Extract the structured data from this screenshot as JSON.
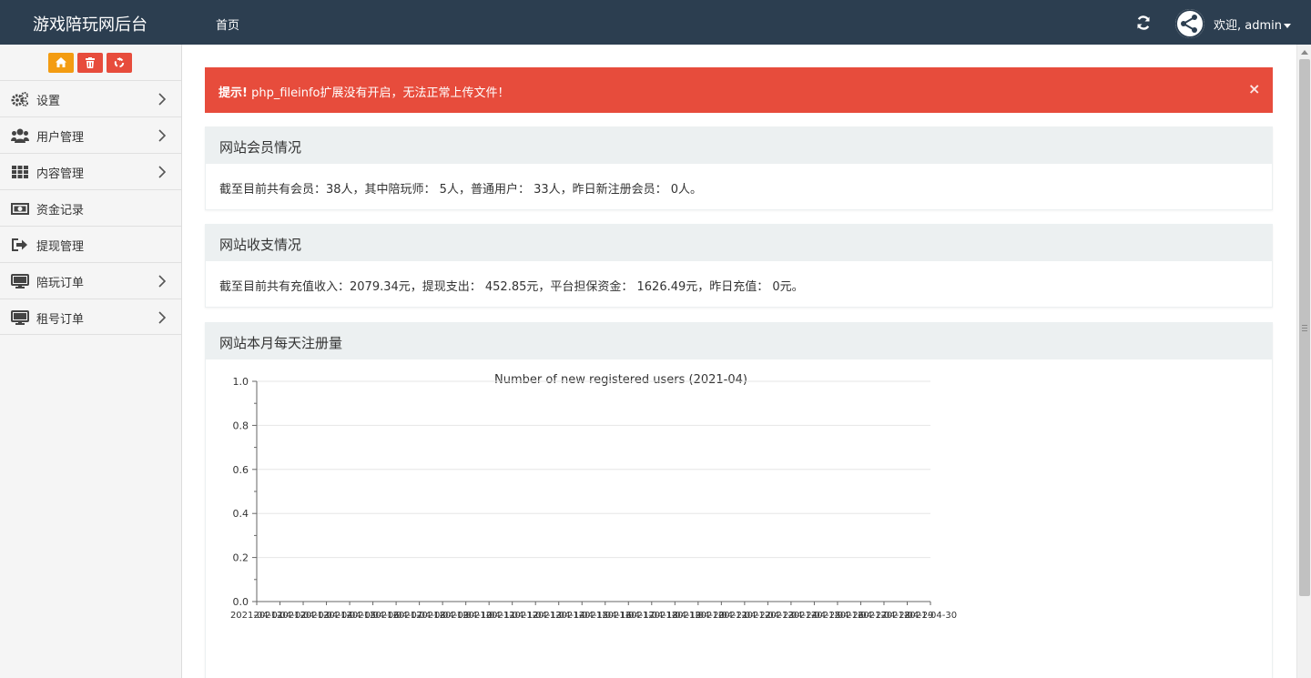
{
  "header": {
    "brand": "游戏陪玩网后台",
    "nav_home": "首页",
    "user_label": "欢迎, admin"
  },
  "sidebar": {
    "quick_buttons": [
      {
        "icon": "home-icon",
        "color": "#f39c12"
      },
      {
        "icon": "trash-icon",
        "color": "#e74c3c"
      },
      {
        "icon": "recycle-icon",
        "color": "#e74c3c"
      }
    ],
    "items": [
      {
        "label": "设置",
        "icon": "gears-icon",
        "has_children": true
      },
      {
        "label": "用户管理",
        "icon": "users-icon",
        "has_children": true
      },
      {
        "label": "内容管理",
        "icon": "grid-icon",
        "has_children": true
      },
      {
        "label": "资金记录",
        "icon": "money-icon",
        "has_children": false
      },
      {
        "label": "提现管理",
        "icon": "sign-out-icon",
        "has_children": false
      },
      {
        "label": "陪玩订单",
        "icon": "desktop-icon",
        "has_children": true
      },
      {
        "label": "租号订单",
        "icon": "desktop-icon",
        "has_children": true
      }
    ]
  },
  "alert": {
    "prefix": "提示!",
    "message": "php_fileinfo扩展没有开启，无法正常上传文件！",
    "close": "×"
  },
  "panels": {
    "members": {
      "title": "网站会员情况",
      "text": "截至目前共有会员：38人，其中陪玩师： 5人，普通用户： 33人，昨日新注册会员： 0人。"
    },
    "finance": {
      "title": "网站收支情况",
      "text": "截至目前共有充值收入：2079.34元，提现支出： 452.85元，平台担保资金： 1626.49元，昨日充值： 0元。"
    },
    "registrations": {
      "title": "网站本月每天注册量"
    }
  },
  "colors": {
    "navbar": "#2c3e50",
    "alert": "#e74c3c",
    "panel_heading": "#ecf0f1",
    "home_button": "#f39c12",
    "danger_button": "#e74c3c"
  },
  "chart_data": {
    "type": "line",
    "title": "Number of new registered users (2021-04)",
    "x": [
      "2021-04-01",
      "2021-04-02",
      "2021-04-03",
      "2021-04-04",
      "2021-04-05",
      "2021-04-06",
      "2021-04-07",
      "2021-04-08",
      "2021-04-09",
      "2021-04-10",
      "2021-04-11",
      "2021-04-12",
      "2021-04-13",
      "2021-04-14",
      "2021-04-15",
      "2021-04-16",
      "2021-04-17",
      "2021-04-18",
      "2021-04-19",
      "2021-04-20",
      "2021-04-21",
      "2021-04-22",
      "2021-04-23",
      "2021-04-24",
      "2021-04-25",
      "2021-04-26",
      "2021-04-27",
      "2021-04-28",
      "2021-04-29",
      "2021-04-30"
    ],
    "series": [],
    "yticks": [
      "0.0",
      "0.2",
      "0.4",
      "0.6",
      "0.8",
      "1.0"
    ],
    "ylim": [
      0,
      1
    ],
    "xlabel": "",
    "ylabel": "",
    "grid": true
  }
}
